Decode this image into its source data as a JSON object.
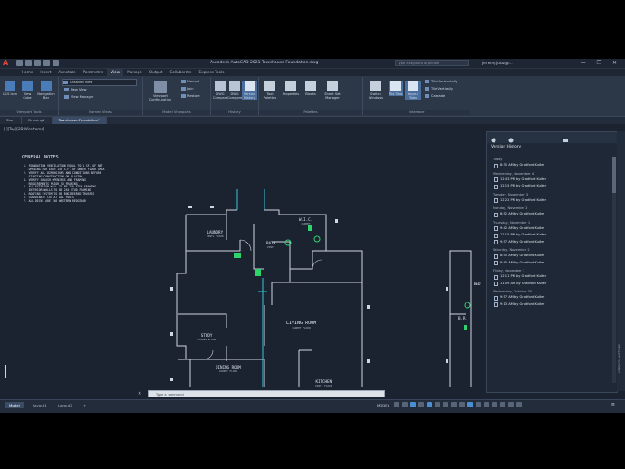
{
  "app": {
    "logo": "A",
    "title": "Autodesk AutoCAD 2021   Townhouse-Foundation.dwg",
    "search_placeholder": "Type a keyword or phrase",
    "user": "jerremy.jusuf@...",
    "window_buttons": "— ❐ ✕"
  },
  "ribbon_tabs": [
    "Home",
    "Insert",
    "Annotate",
    "Parametric",
    "View",
    "Manage",
    "Output",
    "Collaborate",
    "Express Tools"
  ],
  "active_tab": "View",
  "ribbon": {
    "viewport_tools": {
      "label": "Viewport Tools",
      "items": [
        "UCS Icon",
        "View Cube",
        "Navigation Bar"
      ]
    },
    "named_views": {
      "label": "Named Views",
      "items": [
        "Unsaved View",
        "New View",
        "View Manager"
      ]
    },
    "model_viewports": {
      "label": "Model Viewports",
      "big": "Viewport Configuration",
      "items": [
        "Named",
        "Join",
        "Restore"
      ]
    },
    "history": {
      "label": "History",
      "items": [
        "DWG Compare",
        "DWG Compare",
        "Version History"
      ]
    },
    "palettes": {
      "label": "Palettes",
      "items": [
        "Tool Palettes",
        "Properties",
        "Blocks",
        "Sheet Set Manager"
      ]
    },
    "interface": {
      "label": "Interface",
      "items": [
        "Switch Windows",
        "File Tabs",
        "Layout Tabs"
      ],
      "small": [
        "Tile Horizontally",
        "Tile Vertically",
        "Cascade"
      ]
    }
  },
  "file_tabs": [
    "Start",
    "Drawing1",
    "Townhouse-Foundation*"
  ],
  "active_file_tab": "Townhouse-Foundation*",
  "view_label": "[-][Top][2D Wireframe]",
  "notes": {
    "title": "GENERAL NOTES",
    "items": [
      "1. FOUNDATION VENTILATION EQUAL TO 1 SF. OF NET",
      "   OPENING FOR EACH 150 S.F. OF UNDER FLOOR AREA",
      "2. VERIFY ALL DIMENSIONS AND CONDITIONS BEFORE",
      "   STARTING CONSTRUCTION OR PLACING",
      "3. VERIFY SQUASH OPENINGS AND FRAMING",
      "   REQUIREMENTS PRIOR TO FRAMING",
      "4. ALL EXTERIOR WALL TO BE 2X6 STUD FRAMING",
      "   INTERIOR WALLS TO BE 2X4 STUD FRAMING",
      "5. ROOFING SYSTEM TO BE ENGINEERED TRUSSES",
      "6. COORDINATE CUT AT ALL FOOTS",
      "7. ALL DECKS ARE 2X6 WESTERN REDCEDAR"
    ]
  },
  "rooms": [
    {
      "name": "LAUNDRY",
      "sub": "VINYL FLOOR"
    },
    {
      "name": "W.I.C.",
      "sub": "CARPET"
    },
    {
      "name": "BATH",
      "sub": "VINYL"
    },
    {
      "name": "LIVING ROOM",
      "sub": "CARPET FLOOR"
    },
    {
      "name": "STUDY",
      "sub": "CARPET FLOOR"
    },
    {
      "name": "DINING ROOM",
      "sub": "CARPET FLOOR"
    },
    {
      "name": "KITCHEN",
      "sub": "VINYL FLOOR"
    },
    {
      "name": "BED",
      "sub": ""
    },
    {
      "name": "B.R.",
      "sub": ""
    }
  ],
  "version_history": {
    "title": "Version History",
    "groups": [
      {
        "date": "Today",
        "entries": [
          "8:35 AM by Gradford Kuiter"
        ]
      },
      {
        "date": "Wednesday, November 4",
        "entries": [
          "12:43 PM by Gradford Kuiter",
          "12:15 PM by Gradford Kuiter"
        ]
      },
      {
        "date": "Tuesday, November 3",
        "entries": [
          "12:22 PM by Gradford Kuiter"
        ]
      },
      {
        "date": "Monday, November 2",
        "entries": [
          "8:52 AM by Gradford Kuiter"
        ]
      },
      {
        "date": "Thursday, November 1",
        "entries": [
          "9:42 AM by Gradford Kuiter",
          "12:15 PM by Gradford Kuiter",
          "9:57 AM by Gradford Kuiter"
        ]
      },
      {
        "date": "Saturday, November 2",
        "entries": [
          "8:55 AM by Gradford Kuiter",
          "8:45 AM by Gradford Kuiter"
        ]
      },
      {
        "date": "Friday, November 1",
        "entries": [
          "12:11 PM by Gradford Kuiter",
          "11:09 AM by Gradford Kuiter"
        ]
      },
      {
        "date": "Wednesday, October 30",
        "entries": [
          "9:57 AM by Gradford Kuiter",
          "9:13 AM by Gradford Kuiter"
        ]
      }
    ]
  },
  "side_label": "VERSION HISTORY",
  "command_placeholder": "Type a command",
  "layout_tabs": [
    "Model",
    "Layout1",
    "Layout2",
    "+"
  ],
  "status": {
    "model": "MODEL"
  },
  "colors": {
    "background": "#1b2331",
    "ribbon": "#2c3748",
    "accent": "#4a8fd4",
    "linework": "#dfe6ee",
    "highlight": "#2fd36b",
    "cyan": "#37c7d8"
  }
}
